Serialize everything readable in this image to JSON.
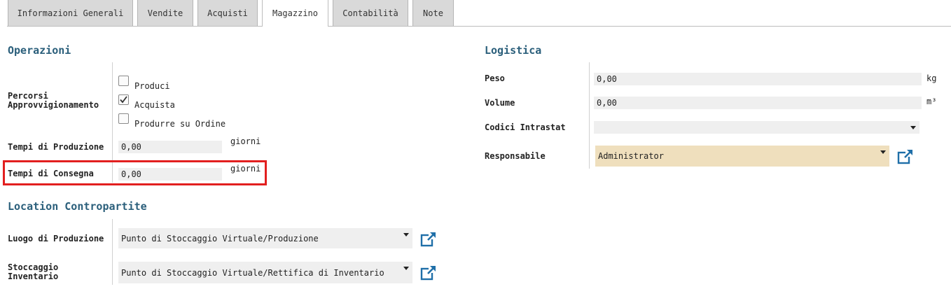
{
  "tabs": [
    {
      "label": "Informazioni Generali",
      "active": false
    },
    {
      "label": "Vendite",
      "active": false
    },
    {
      "label": "Acquisti",
      "active": false
    },
    {
      "label": "Magazzino",
      "active": true
    },
    {
      "label": "Contabilità",
      "active": false
    },
    {
      "label": "Note",
      "active": false
    }
  ],
  "operazioni": {
    "title": "Operazioni",
    "percorsi": {
      "label_line1": "Percorsi",
      "label_line2": "Approvvigionamento",
      "options": [
        {
          "label": "Produci",
          "checked": false
        },
        {
          "label": "Acquista",
          "checked": true
        },
        {
          "label": "Produrre su Ordine",
          "checked": false
        }
      ]
    },
    "tempi_produzione": {
      "label": "Tempi di Produzione",
      "value": "0,00",
      "unit": "giorni"
    },
    "tempi_consegna": {
      "label": "Tempi di Consegna",
      "value": "0,00",
      "unit": "giorni"
    }
  },
  "location": {
    "title": "Location Contropartite",
    "luogo_produzione": {
      "label": "Luogo di Produzione",
      "value": "Punto di Stoccaggio Virtuale/Produzione"
    },
    "stoccaggio_inventario": {
      "label_line1": "Stoccaggio",
      "label_line2": "Inventario",
      "value": "Punto di Stoccaggio Virtuale/Rettifica di Inventario"
    }
  },
  "logistica": {
    "title": "Logistica",
    "peso": {
      "label": "Peso",
      "value": "0,00",
      "unit": "kg"
    },
    "volume": {
      "label": "Volume",
      "value": "0,00",
      "unit": "m³"
    },
    "codici_intrastat": {
      "label": "Codici Intrastat",
      "value": ""
    },
    "responsabile": {
      "label": "Responsabile",
      "value": "Administrator"
    }
  },
  "colors": {
    "section_title": "#2b5f7b",
    "highlight_border": "#e21f1f",
    "external_link_icon": "#1f6fa8",
    "responsabile_bg": "#efdfbd"
  }
}
